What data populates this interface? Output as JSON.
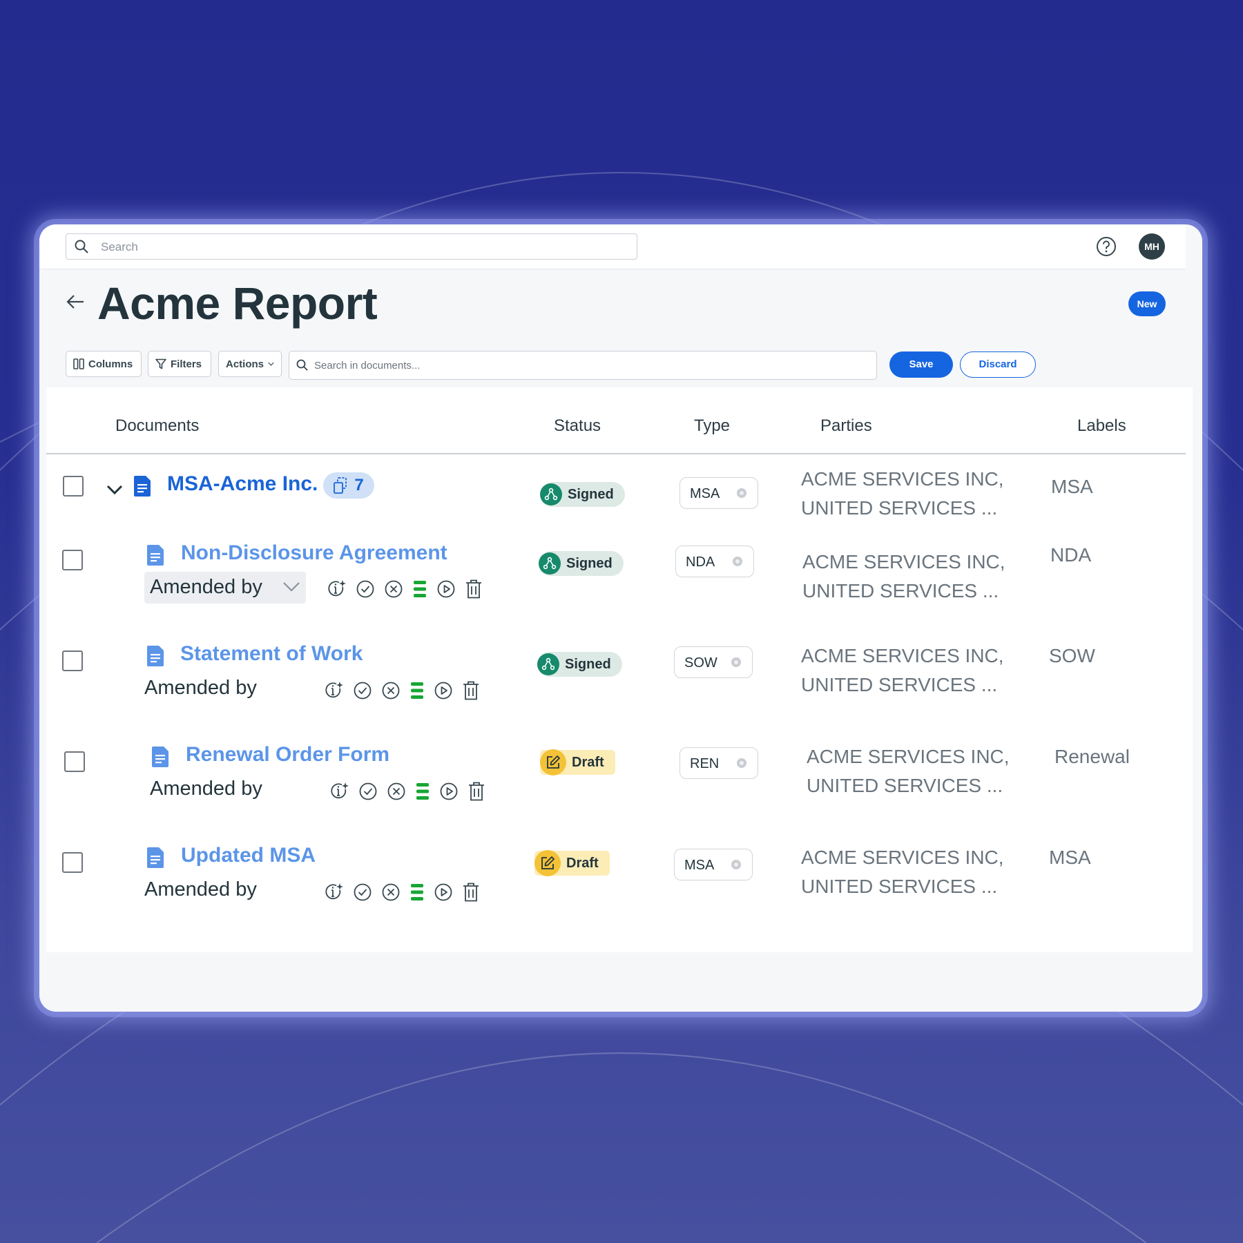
{
  "topbar": {
    "search_placeholder": "Search",
    "avatar_initials": "MH"
  },
  "page": {
    "title": "Acme Report",
    "new_badge": "New"
  },
  "toolbar": {
    "columns_label": "Columns",
    "filters_label": "Filters",
    "actions_label": "Actions",
    "search_placeholder": "Search in documents...",
    "save_label": "Save",
    "discard_label": "Discard"
  },
  "table": {
    "headers": {
      "documents": "Documents",
      "status": "Status",
      "type": "Type",
      "parties": "Parties",
      "labels": "Labels"
    },
    "rows": [
      {
        "name": "MSA-Acme Inc.",
        "count": "7",
        "status": "Signed",
        "type": "MSA",
        "parties_line1": "ACME SERVICES INC,",
        "parties_line2": "UNITED SERVICES ...",
        "label": "MSA"
      },
      {
        "name": "Non-Disclosure Agreement",
        "amended": "Amended by",
        "status": "Signed",
        "type": "NDA",
        "parties_line1": "ACME SERVICES INC,",
        "parties_line2": "UNITED SERVICES ...",
        "label": "NDA"
      },
      {
        "name": "Statement of Work",
        "amended": "Amended by",
        "status": "Signed",
        "type": "SOW",
        "parties_line1": "ACME SERVICES INC,",
        "parties_line2": "UNITED SERVICES ...",
        "label": "SOW"
      },
      {
        "name": "Renewal Order Form",
        "amended": "Amended by",
        "status": "Draft",
        "type": "REN",
        "parties_line1": "ACME SERVICES INC,",
        "parties_line2": "UNITED SERVICES ...",
        "label": "Renewal"
      },
      {
        "name": "Updated MSA",
        "amended": "Amended by",
        "status": "Draft",
        "type": "MSA",
        "parties_line1": "ACME SERVICES INC,",
        "parties_line2": "UNITED SERVICES ...",
        "label": "MSA"
      }
    ]
  },
  "colors": {
    "primary": "#1565e0",
    "signed": "#168a6b",
    "draft": "#f3c237",
    "background": "#232b8e"
  },
  "icons": [
    "search-icon",
    "help-icon",
    "back-arrow-icon",
    "columns-icon",
    "filter-icon",
    "chevron-down-icon",
    "document-icon",
    "linked-docs-icon",
    "info-sparkle-icon",
    "check-circle-icon",
    "x-circle-icon",
    "list-icon",
    "play-circle-icon",
    "trash-icon",
    "signed-icon",
    "edit-icon"
  ]
}
